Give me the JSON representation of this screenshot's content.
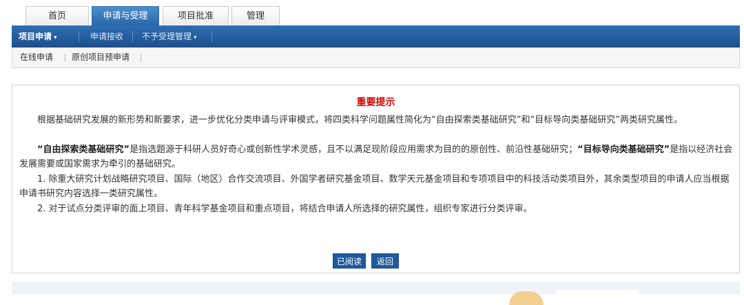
{
  "tabs": [
    {
      "label": "首页",
      "active": false
    },
    {
      "label": "申请与受理",
      "active": true
    },
    {
      "label": "项目批准",
      "active": false
    },
    {
      "label": "管理",
      "active": false
    }
  ],
  "nav": {
    "items": [
      {
        "label": "项目申请",
        "active": true,
        "dropdown": true
      },
      {
        "label": "申请接收",
        "active": false,
        "dropdown": false
      },
      {
        "label": "不予受理管理",
        "active": false,
        "dropdown": true
      }
    ]
  },
  "subnav": {
    "items": [
      {
        "label": "在线申请"
      },
      {
        "label": "原创项目预申请"
      }
    ]
  },
  "notice": {
    "title": "重要提示",
    "p1": "根据基础研究发展的新形势和新要求，进一步优化分类申请与评审模式，将四类科学问题属性简化为“自由探索类基础研究”和“目标导向类基础研究”两类研究属性。",
    "p2_bold1": "“自由探索类基础研究”",
    "p2_text1": "是指选题源于科研人员好奇心或创新性学术灵感，且不以满足现阶段应用需求为目的的原创性、前沿性基础研究；",
    "p2_bold2": "“目标导向类基础研究”",
    "p2_text2": "是指以经济社会发展需要或国家需求为牵引的基础研究。",
    "p3": "1. 除重大研究计划战略研究项目、国际（地区）合作交流项目、外国学者研究基金项目、数学天元基金项目和专项项目中的科技活动类项目外，其余类型项目的申请人应当根据申请书研究内容选择一类研究属性。",
    "p4": "2. 对于试点分类评审的面上项目、青年科学基金项目和重点项目，将结合申请人所选择的研究属性，组织专家进行分类评审。"
  },
  "buttons": {
    "read": "已阅读",
    "back": "返回"
  },
  "icons": {
    "caret": "▾"
  }
}
